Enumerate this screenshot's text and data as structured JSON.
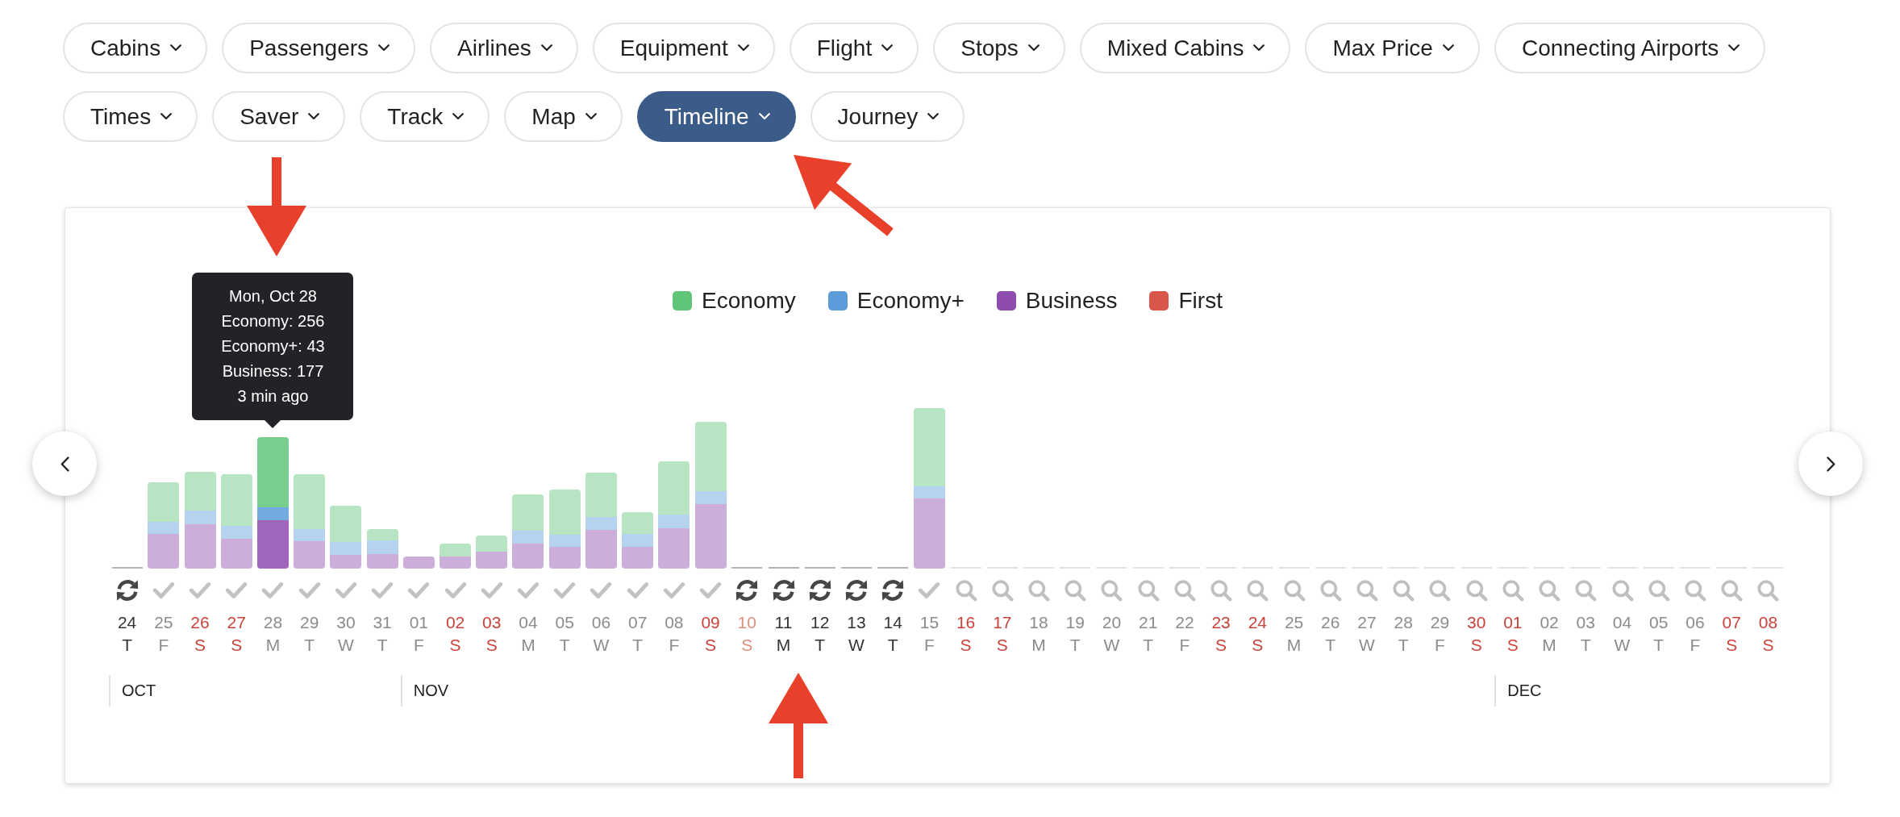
{
  "filter_rows": [
    [
      {
        "label": "Cabins",
        "selected": false
      },
      {
        "label": "Passengers",
        "selected": false
      },
      {
        "label": "Airlines",
        "selected": false
      },
      {
        "label": "Equipment",
        "selected": false
      },
      {
        "label": "Flight",
        "selected": false
      },
      {
        "label": "Stops",
        "selected": false
      },
      {
        "label": "Mixed Cabins",
        "selected": false
      },
      {
        "label": "Max Price",
        "selected": false
      },
      {
        "label": "Connecting Airports",
        "selected": false
      }
    ],
    [
      {
        "label": "Times",
        "selected": false
      },
      {
        "label": "Saver",
        "selected": false
      },
      {
        "label": "Track",
        "selected": false
      },
      {
        "label": "Map",
        "selected": false
      },
      {
        "label": "Timeline",
        "selected": true
      },
      {
        "label": "Journey",
        "selected": false
      }
    ]
  ],
  "chart": {
    "legend": [
      {
        "label": "Economy",
        "color": "#5fc679"
      },
      {
        "label": "Economy+",
        "color": "#5b9bd9"
      },
      {
        "label": "Business",
        "color": "#8e4bb0"
      },
      {
        "label": "First",
        "color": "#d9574a"
      }
    ],
    "tooltip": {
      "lines": [
        "Mon, Oct 28",
        "Economy: 256",
        "Economy+: 43",
        "Business: 177",
        "3 min ago"
      ]
    },
    "months": [
      {
        "label": "OCT",
        "days": [
          {
            "date": "24",
            "weekday": "T",
            "weekend": false,
            "kind": "refresh",
            "selected": false
          },
          {
            "date": "25",
            "weekday": "F",
            "weekend": false,
            "kind": "check",
            "selected": false
          },
          {
            "date": "26",
            "weekday": "S",
            "weekend": true,
            "kind": "check",
            "selected": false
          },
          {
            "date": "27",
            "weekday": "S",
            "weekend": true,
            "kind": "check",
            "selected": false
          },
          {
            "date": "28",
            "weekday": "M",
            "weekend": false,
            "kind": "check",
            "selected": true
          },
          {
            "date": "29",
            "weekday": "T",
            "weekend": false,
            "kind": "check",
            "selected": false
          },
          {
            "date": "30",
            "weekday": "W",
            "weekend": false,
            "kind": "check",
            "selected": false
          },
          {
            "date": "31",
            "weekday": "T",
            "weekend": false,
            "kind": "check",
            "selected": false
          }
        ]
      },
      {
        "label": "NOV",
        "days": [
          {
            "date": "01",
            "weekday": "F",
            "weekend": false,
            "kind": "check",
            "selected": false
          },
          {
            "date": "02",
            "weekday": "S",
            "weekend": true,
            "kind": "check",
            "selected": false
          },
          {
            "date": "03",
            "weekday": "S",
            "weekend": true,
            "kind": "check",
            "selected": false
          },
          {
            "date": "04",
            "weekday": "M",
            "weekend": false,
            "kind": "check",
            "selected": false
          },
          {
            "date": "05",
            "weekday": "T",
            "weekend": false,
            "kind": "check",
            "selected": false
          },
          {
            "date": "06",
            "weekday": "W",
            "weekend": false,
            "kind": "check",
            "selected": false
          },
          {
            "date": "07",
            "weekday": "T",
            "weekend": false,
            "kind": "check",
            "selected": false
          },
          {
            "date": "08",
            "weekday": "F",
            "weekend": false,
            "kind": "check",
            "selected": false
          },
          {
            "date": "09",
            "weekday": "S",
            "weekend": true,
            "kind": "check",
            "selected": false
          },
          {
            "date": "10",
            "weekday": "S",
            "weekend": true,
            "kind": "refresh",
            "selected": false
          },
          {
            "date": "11",
            "weekday": "M",
            "weekend": false,
            "kind": "refresh",
            "selected": false
          },
          {
            "date": "12",
            "weekday": "T",
            "weekend": false,
            "kind": "refresh",
            "selected": false
          },
          {
            "date": "13",
            "weekday": "W",
            "weekend": false,
            "kind": "refresh",
            "selected": false
          },
          {
            "date": "14",
            "weekday": "T",
            "weekend": false,
            "kind": "refresh",
            "selected": false
          },
          {
            "date": "15",
            "weekday": "F",
            "weekend": false,
            "kind": "check",
            "selected": false
          },
          {
            "date": "16",
            "weekday": "S",
            "weekend": true,
            "kind": "search",
            "selected": false
          },
          {
            "date": "17",
            "weekday": "S",
            "weekend": true,
            "kind": "search",
            "selected": false
          },
          {
            "date": "18",
            "weekday": "M",
            "weekend": false,
            "kind": "search",
            "selected": false
          },
          {
            "date": "19",
            "weekday": "T",
            "weekend": false,
            "kind": "search",
            "selected": false
          },
          {
            "date": "20",
            "weekday": "W",
            "weekend": false,
            "kind": "search",
            "selected": false
          },
          {
            "date": "21",
            "weekday": "T",
            "weekend": false,
            "kind": "search",
            "selected": false
          },
          {
            "date": "22",
            "weekday": "F",
            "weekend": false,
            "kind": "search",
            "selected": false
          },
          {
            "date": "23",
            "weekday": "S",
            "weekend": true,
            "kind": "search",
            "selected": false
          },
          {
            "date": "24",
            "weekday": "S",
            "weekend": true,
            "kind": "search",
            "selected": false
          },
          {
            "date": "25",
            "weekday": "M",
            "weekend": false,
            "kind": "search",
            "selected": false
          },
          {
            "date": "26",
            "weekday": "T",
            "weekend": false,
            "kind": "search",
            "selected": false
          },
          {
            "date": "27",
            "weekday": "W",
            "weekend": false,
            "kind": "search",
            "selected": false
          },
          {
            "date": "28",
            "weekday": "T",
            "weekend": false,
            "kind": "search",
            "selected": false
          },
          {
            "date": "29",
            "weekday": "F",
            "weekend": false,
            "kind": "search",
            "selected": false
          },
          {
            "date": "30",
            "weekday": "S",
            "weekend": true,
            "kind": "search",
            "selected": false
          }
        ]
      },
      {
        "label": "DEC",
        "days": [
          {
            "date": "01",
            "weekday": "S",
            "weekend": true,
            "kind": "search",
            "selected": false
          },
          {
            "date": "02",
            "weekday": "M",
            "weekend": false,
            "kind": "search",
            "selected": false
          },
          {
            "date": "03",
            "weekday": "T",
            "weekend": false,
            "kind": "search",
            "selected": false
          },
          {
            "date": "04",
            "weekday": "W",
            "weekend": false,
            "kind": "search",
            "selected": false
          },
          {
            "date": "05",
            "weekday": "T",
            "weekend": false,
            "kind": "search",
            "selected": false
          },
          {
            "date": "06",
            "weekday": "F",
            "weekend": false,
            "kind": "search",
            "selected": false
          },
          {
            "date": "07",
            "weekday": "S",
            "weekend": true,
            "kind": "search",
            "selected": false
          },
          {
            "date": "08",
            "weekday": "S",
            "weekend": true,
            "kind": "search",
            "selected": false
          }
        ]
      }
    ]
  }
}
